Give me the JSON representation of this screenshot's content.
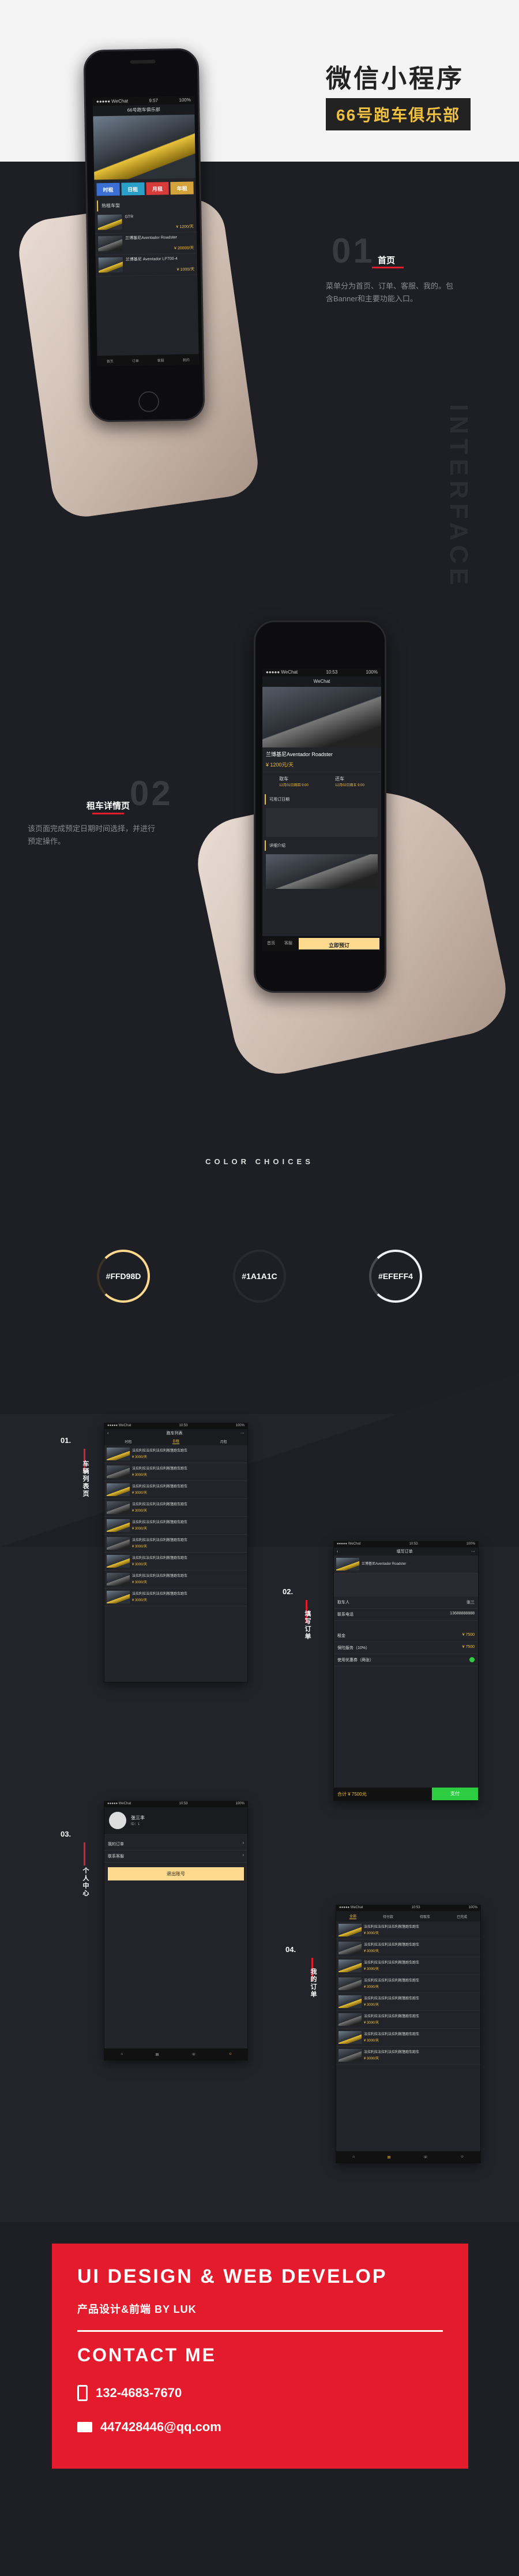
{
  "header": {
    "title": "微信小程序",
    "subtitle": "66号跑车俱乐部"
  },
  "vertical_word": "INTERFACE",
  "section1": {
    "number": "01",
    "label": "首页",
    "desc": [
      "菜单分为首页、订单、客服、我的。包",
      "含Banner和主要功能入口。"
    ]
  },
  "section2": {
    "number": "02",
    "label": "租车详情页",
    "desc": [
      "该页面完成预定日期时间选择，并进行",
      "预定操作。"
    ]
  },
  "phone1": {
    "status_left": "●●●●● WeChat",
    "status_time": "9:57",
    "status_right": "100%",
    "nav_title": "66号跑车俱乐部",
    "tiles": [
      "时租",
      "日租",
      "月租",
      "年租"
    ],
    "tile_colors": [
      "#3b6fd4",
      "#2aa0c8",
      "#d93a3a",
      "#d4a23a"
    ],
    "section_title": "热租车型",
    "cars": [
      {
        "name": "GTR",
        "tags": "",
        "price": "¥ 1200/天"
      },
      {
        "name": "兰博基尼Aventador Roadster",
        "tags": "",
        "price": "¥ 20000/天"
      },
      {
        "name": "兰博基尼 Aventador LP700-4",
        "tags": "",
        "price": "¥ 1000/天"
      }
    ],
    "tabbar": [
      "首页",
      "订单",
      "客服",
      "我的"
    ]
  },
  "phone2": {
    "status_left": "●●●●● WeChat",
    "status_time": "10:53",
    "status_right": "100%",
    "nav_title": "WeChat",
    "car_name": "兰博基尼Aventador Roadster",
    "price": "¥ 1200元/天",
    "pickup_label": "取车",
    "return_label": "还车",
    "pickup_time": "12月01日周四 9:00",
    "return_time": "12月02日周五 9:00",
    "section1": "可用订日期",
    "section2": "详细介绍",
    "book_button": "立即预订",
    "tabbar": [
      "首页",
      "客服"
    ]
  },
  "colors": {
    "title": "COLOR CHOICES",
    "swatches": [
      {
        "label": "#FFD98D",
        "color": "#FFD98D"
      },
      {
        "label": "#1A1A1C",
        "color": "#1A1A1C"
      },
      {
        "label": "#EFEFF4",
        "color": "#EFEFF4"
      }
    ]
  },
  "shots": {
    "s1": {
      "num": "01.",
      "label": "车辆列表页",
      "title": "跑车列表",
      "tabs": [
        "时租",
        "日租",
        "月租"
      ]
    },
    "s2": {
      "num": "02.",
      "label": "填写订单",
      "title": "填写订单",
      "car": "兰博基尼Aventador Roadster",
      "rows": [
        {
          "k": "取车人",
          "v": "张三"
        },
        {
          "k": "联系电话",
          "v": "13688888888"
        },
        {
          "k": "租金",
          "v": "¥ 7500"
        },
        {
          "k": "保险服务（10%）",
          "v": "¥ 7500"
        },
        {
          "k": "使用优惠券（两张）",
          "v": ""
        }
      ],
      "total": "合计 ¥ 7500元",
      "pay": "支付"
    },
    "s3": {
      "num": "03.",
      "label": "个人中心",
      "user": "张三丰",
      "user_id": "ID：1",
      "rows": [
        "我的订单",
        "联系客服"
      ],
      "button": "退出账号"
    },
    "s4": {
      "num": "04.",
      "label": "我的订单",
      "tabs": [
        "全部",
        "待付款",
        "待取车",
        "已完成"
      ]
    },
    "list_text": "法拉利拉法拉利法拉利敞篷跑车跑车",
    "list_price": "¥ 3000/天"
  },
  "contact": {
    "heading": "UI DESIGN & WEB DEVELOP",
    "sub": "产品设计&前端 BY LUK",
    "title": "CONTACT ME",
    "phone": "132-4683-7670",
    "email": "447428446@qq.com"
  }
}
